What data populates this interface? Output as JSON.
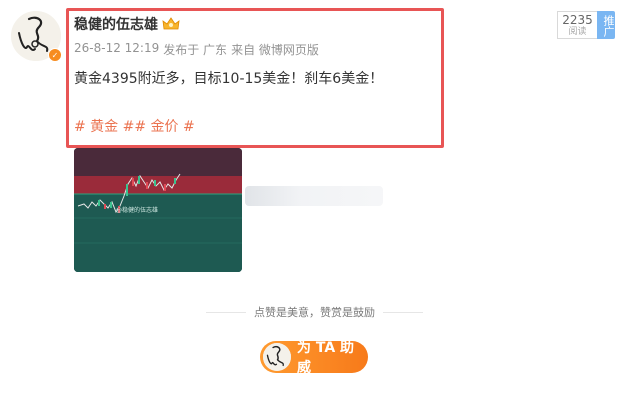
{
  "post": {
    "username": "稳健的伍志雄",
    "date": "26-8-12 12:19",
    "location": "发布于 广东",
    "source": "来自 微博网页版",
    "text": "黄金4395附近多，目标10-15美金！刹车6美金！",
    "tags": "# 黄金 ## 金价 #",
    "image_watermark": "@稳健的伍志雄"
  },
  "stats": {
    "count": "2235",
    "label": "阅读",
    "promote": "推广"
  },
  "reward": {
    "slogan": "点赞是美意，赞赏是鼓励",
    "button": "为 TA 助威"
  },
  "icons": {
    "crown": "crown-icon",
    "verified": "verified-badge-icon"
  },
  "colors": {
    "highlight": "#e85555",
    "tag": "#eb7350",
    "reward": "#f78c1f",
    "promote": "#7ab6f2"
  }
}
